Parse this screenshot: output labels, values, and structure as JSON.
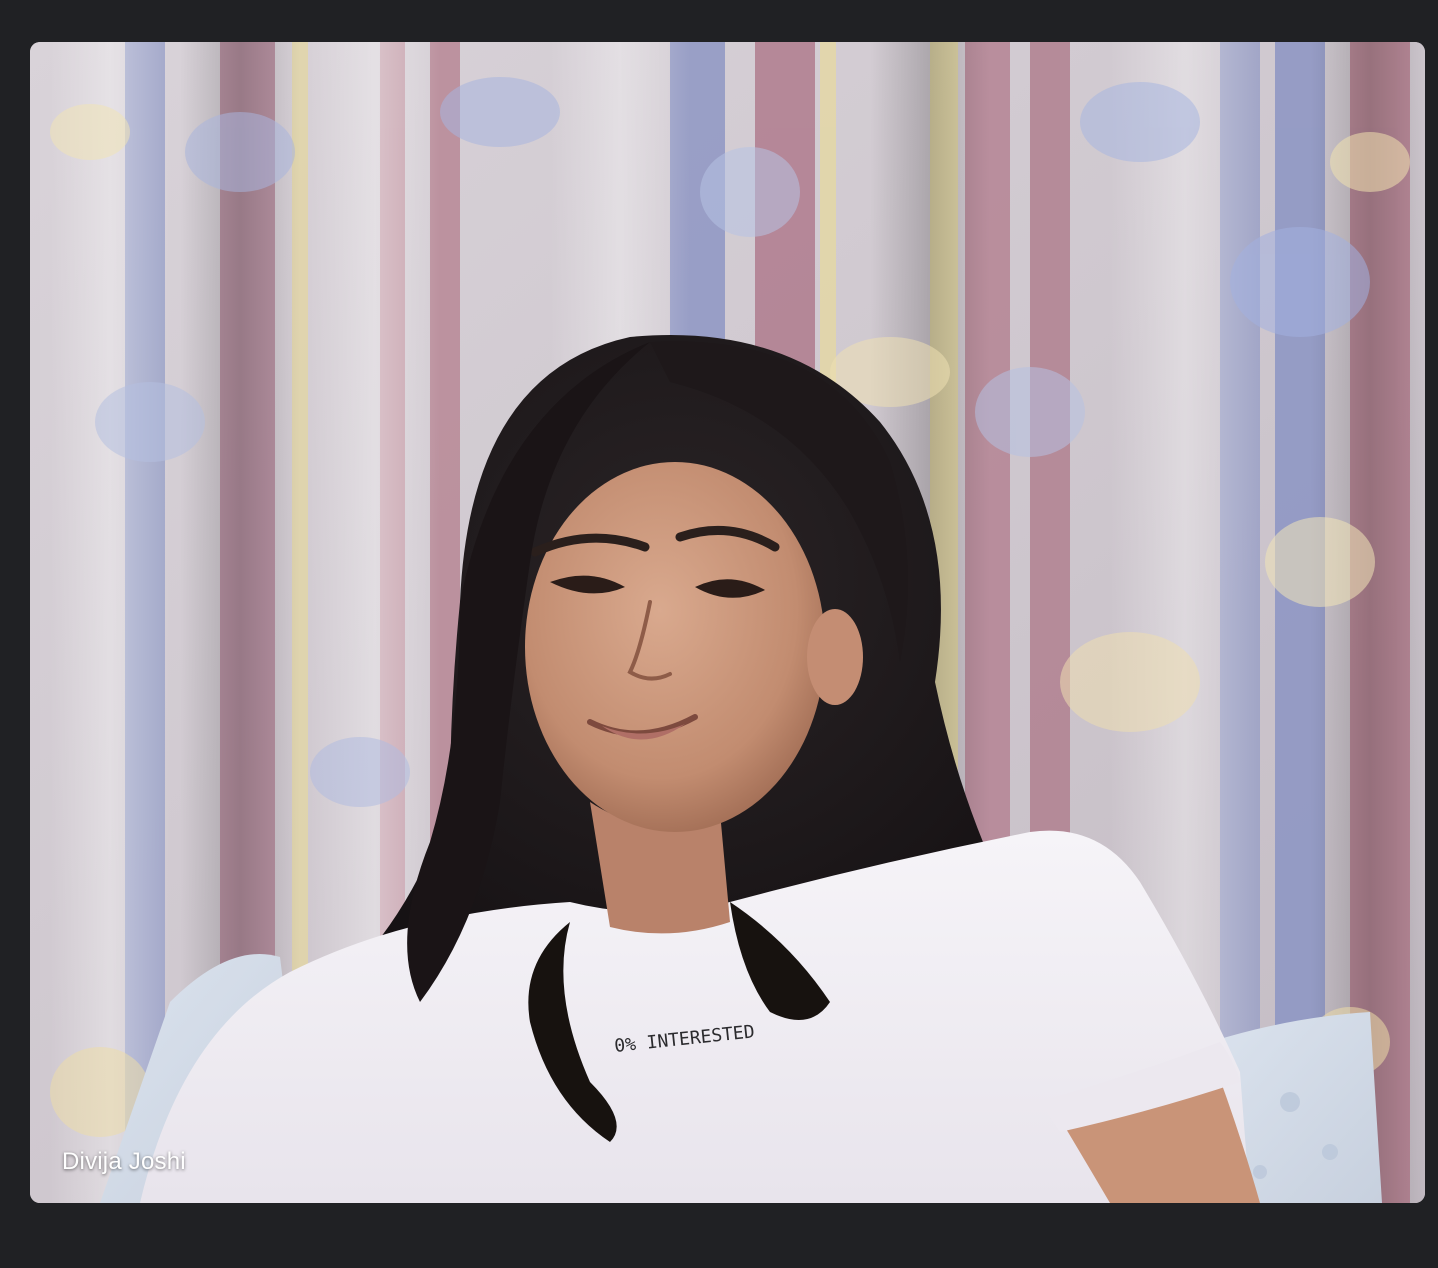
{
  "participant": {
    "name": "Divija Joshi"
  },
  "video_feed": {
    "content": "webcam-feed"
  },
  "shirt_print": "0% INTERESTED",
  "colors": {
    "app_background": "#202124",
    "name_text": "#ffffff"
  }
}
